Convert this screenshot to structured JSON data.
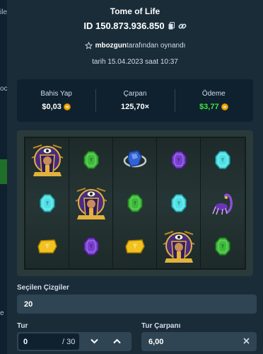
{
  "game_title": "Tome of Life",
  "bet_id": "ID 150.873.936.850",
  "played_by": {
    "username": "mbozgun",
    "suffix": "tarafından oynandı"
  },
  "date": "tarih 15.04.2023 saat 10:37",
  "stats": {
    "bet_label": "Bahis Yap",
    "bet_value": "$0,03",
    "multiplier_label": "Çarpan",
    "multiplier_value": "125,70×",
    "payout_label": "Ödeme",
    "payout_value": "$3,77"
  },
  "reels": [
    [
      "pharaoh",
      "green-gem",
      "blue-gem"
    ],
    [
      "purple-gem",
      "cyan-gem",
      "pharaoh"
    ],
    [
      "green-gem",
      "cyan-gem",
      "scorpion"
    ],
    [
      "yellow-gem",
      "purple-gem",
      "yellow-gem"
    ],
    [
      "pharaoh",
      "green-gem"
    ]
  ],
  "grid": [
    [
      "pharaoh",
      "green-gem",
      "blue-ring-gem",
      "purple-gem",
      "cyan-gem"
    ],
    [
      "cyan-gem",
      "pharaoh",
      "green-gem",
      "cyan-gem",
      "scorpion"
    ],
    [
      "yellow-gem",
      "purple-gem",
      "yellow-gem",
      "pharaoh",
      "green-gem"
    ]
  ],
  "selected_lines": {
    "label": "Seçilen Çizgiler",
    "value": "20"
  },
  "rounds": {
    "label": "Tur",
    "value": "0",
    "total": "/ 30"
  },
  "round_multiplier": {
    "label": "Tur Çarpanı",
    "value": "6,00"
  },
  "left_strip_text": [
    "ile",
    "oc",
    "e"
  ],
  "colors": {
    "background": "#1a2c38",
    "panel": "#0f212e",
    "input": "#2f4553",
    "payout": "#3ce53c",
    "coin": "#f3a712"
  }
}
